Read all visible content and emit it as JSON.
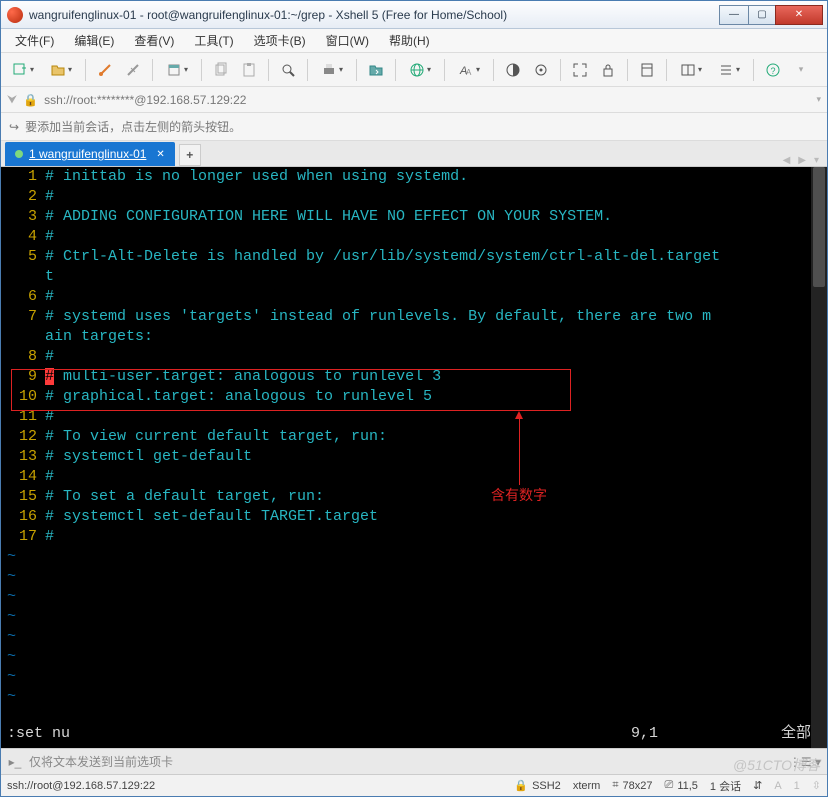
{
  "title": "wangruifenglinux-01 - root@wangruifenglinux-01:~/grep - Xshell 5 (Free for Home/School)",
  "menu": [
    "文件(F)",
    "编辑(E)",
    "查看(V)",
    "工具(T)",
    "选项卡(B)",
    "窗口(W)",
    "帮助(H)"
  ],
  "address": "ssh://root:********@192.168.57.129:22",
  "hint": "要添加当前会话，点击左侧的箭头按钮。",
  "tab": {
    "label": "1 wangruifenglinux-01"
  },
  "terminal": {
    "lines": [
      {
        "n": 1,
        "t": "# inittab is no longer used when using systemd."
      },
      {
        "n": 2,
        "t": "#"
      },
      {
        "n": 3,
        "t": "# ADDING CONFIGURATION HERE WILL HAVE NO EFFECT ON YOUR SYSTEM."
      },
      {
        "n": 4,
        "t": "#"
      },
      {
        "n": 5,
        "t": "# Ctrl-Alt-Delete is handled by /usr/lib/systemd/system/ctrl-alt-del.target",
        "wrap": "t"
      },
      {
        "n": 6,
        "t": "#"
      },
      {
        "n": 7,
        "t": "# systemd uses 'targets' instead of runlevels. By default, there are two m",
        "wrap": "ain targets:"
      },
      {
        "n": 8,
        "t": "#"
      },
      {
        "n": 9,
        "t": "# multi-user.target: analogous to runlevel 3",
        "hl": true
      },
      {
        "n": 10,
        "t": "# graphical.target: analogous to runlevel 5"
      },
      {
        "n": 11,
        "t": "#"
      },
      {
        "n": 12,
        "t": "# To view current default target, run:"
      },
      {
        "n": 13,
        "t": "# systemctl get-default"
      },
      {
        "n": 14,
        "t": "#"
      },
      {
        "n": 15,
        "t": "# To set a default target, run:"
      },
      {
        "n": 16,
        "t": "# systemctl set-default TARGET.target"
      },
      {
        "n": 17,
        "t": "#"
      }
    ],
    "cmd": ":set nu",
    "pos": "9,1",
    "all": "全部"
  },
  "annotation": "含有数字",
  "sendbar": "仅将文本发送到当前选项卡",
  "status": {
    "addr": "ssh://root@192.168.57.129:22",
    "ssh": "SSH2",
    "term": "xterm",
    "size": "78x27",
    "enc": "11,5",
    "sess": "1 会话",
    "net": "↑  ↓"
  },
  "watermark": "@51CTO博客"
}
